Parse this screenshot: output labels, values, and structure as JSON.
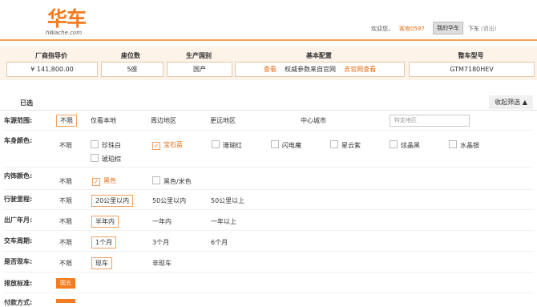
{
  "logo": {
    "cn": "华车",
    "en": "hWache.com"
  },
  "header": {
    "welcome": "欢迎您，",
    "user": "客官0597",
    "my_huache": "我的华车",
    "logout": "下车",
    "logout_paren": "(退出)"
  },
  "summary": {
    "headers": [
      "厂商指导价",
      "座位数",
      "生产国别",
      "基本配置",
      "整车型号"
    ],
    "price": "¥ 141,800.00",
    "seats": "5座",
    "country": "国产",
    "config_view": "查看",
    "config_text": "权威参数来自官网",
    "config_site": "去官网查看",
    "model": "GTM7180HEV"
  },
  "selected_label": "已选",
  "collapse_label": "收起筛选",
  "filters": {
    "range": {
      "label": "车源范围:",
      "options": [
        "不限",
        "仅看本地",
        "周边地区",
        "更远地区",
        "中心城市"
      ],
      "placeholder": "特定地区"
    },
    "body_color": {
      "label": "车身颜色:",
      "options": [
        "不限",
        "珍珠白",
        "宝石蓝",
        "珊瑚红",
        "闪电魔",
        "星云紫",
        "炫晶黑",
        "水晶银",
        "琥珀棕"
      ]
    },
    "interior_color": {
      "label": "内饰颜色:",
      "options": [
        "不限",
        "黑色",
        "黑色/米色"
      ]
    },
    "mileage": {
      "label": "行驶里程:",
      "options": [
        "不限",
        "20公里以内",
        "50公里以内",
        "50公里以上"
      ]
    },
    "factory_date": {
      "label": "出厂年月:",
      "options": [
        "不限",
        "半年内",
        "一年内",
        "一年以上"
      ]
    },
    "delivery": {
      "label": "交车周期:",
      "options": [
        "不限",
        "1个月",
        "3个月",
        "6个月"
      ]
    },
    "in_stock": {
      "label": "是否现车:",
      "options": [
        "不限",
        "现车",
        "非现车"
      ]
    },
    "emission": {
      "label": "排放标准:",
      "options": [
        "国五"
      ]
    },
    "payment": {
      "label": "付款方式:"
    }
  }
}
